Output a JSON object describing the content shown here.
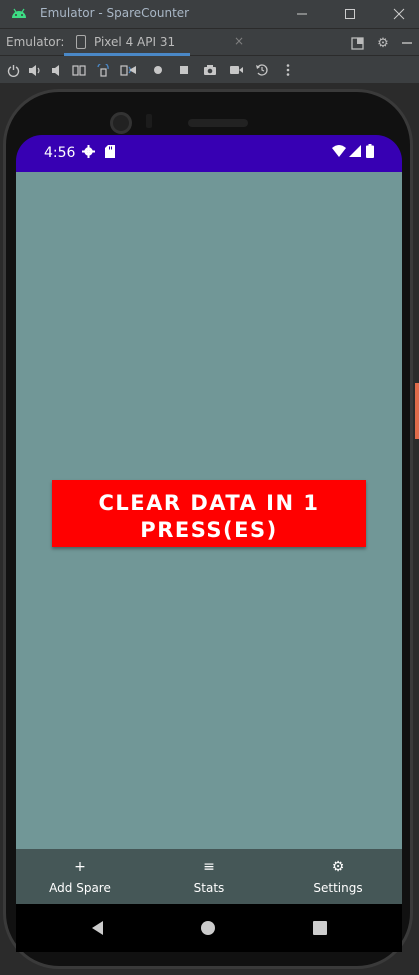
{
  "window": {
    "title": "Emulator - SpareCounter"
  },
  "tabbar": {
    "label": "Emulator:",
    "tab_label": "Pixel 4 API 31",
    "tab_close": "×"
  },
  "statusbar": {
    "time": "4:56"
  },
  "main": {
    "clear_button_line1": "CLEAR DATA IN 1",
    "clear_button_line2": "PRESS(ES)"
  },
  "bottom_nav": {
    "items": [
      {
        "label": "Add Spare",
        "icon": "plus-icon",
        "glyph": "+"
      },
      {
        "label": "Stats",
        "icon": "menu-icon",
        "glyph": "≡"
      },
      {
        "label": "Settings",
        "icon": "gear-icon",
        "glyph": "⚙"
      }
    ]
  },
  "colors": {
    "status_bar": "#3700b3",
    "background": "#719797",
    "button": "#ff0000",
    "bottom_nav": "#455757",
    "tab_underline": "#4a88c7"
  }
}
